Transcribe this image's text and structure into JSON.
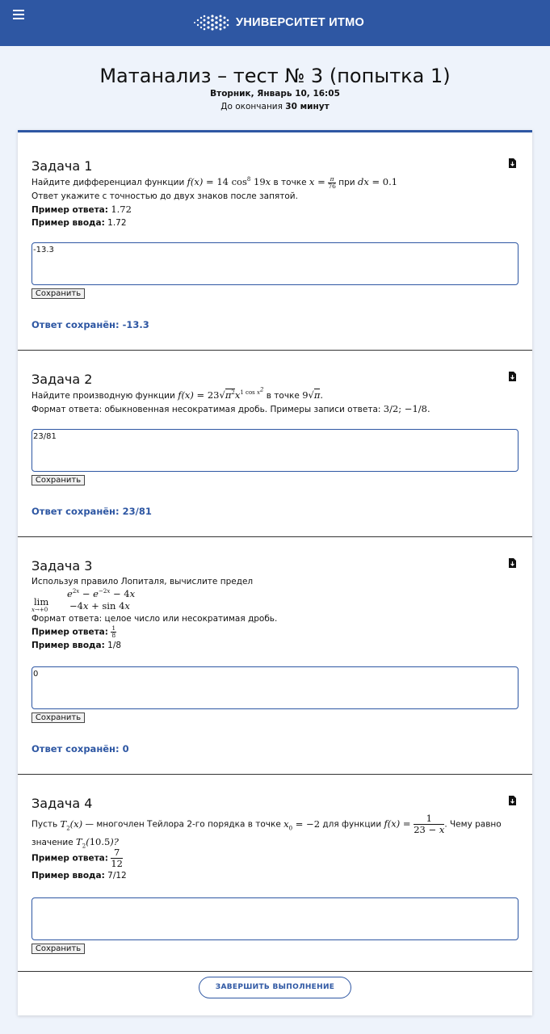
{
  "header": {
    "brand": "УНИВЕРСИТЕТ ИТМО",
    "menu_icon": "hamburger-menu-icon",
    "bg_color": "#2e57a3"
  },
  "page": {
    "title": "Матанализ – тест № 3 (попытка 1)",
    "date": "Вторник, Январь 10, 16:05",
    "time_left_prefix": "До окончания",
    "time_left_value": "30 минут"
  },
  "common": {
    "save_label": "Сохранить",
    "saved_prefix": "Ответ сохранён:",
    "example_answer_label": "Пример ответа:",
    "example_input_label": "Пример ввода:"
  },
  "tasks": [
    {
      "title": "Задача 1",
      "q_lead": "Найдите дифференциал функции",
      "q_at_point": "в точке",
      "q_with": "при",
      "q_precision": "Ответ укажите с точностью до двух знаков после запятой.",
      "example_answer": "1.72",
      "example_input": "1.72",
      "answer_value": "-13.3",
      "saved_value": "-13.3"
    },
    {
      "title": "Задача 2",
      "q_lead": "Найдите производную функции",
      "q_at_point": "в точке",
      "q_format": "Формат ответа: обыкновенная несократимая дробь. Примеры записи ответа:",
      "answer_value": "23/81",
      "saved_value": "23/81"
    },
    {
      "title": "Задача 3",
      "q_lead": "Используя правило Лопиталя, вычислите предел",
      "q_format": "Формат ответа: целое число или несократимая дробь.",
      "example_input": "1/8",
      "answer_value": "0",
      "saved_value": "0"
    },
    {
      "title": "Задача 4",
      "q_part1": "Пусть",
      "q_part2": "— многочлен Тейлора 2-го порядка в точке",
      "q_part3": "для функции",
      "q_part4": ". Чему равно",
      "q_part5": "значение",
      "example_input": "7/12",
      "answer_value": ""
    }
  ],
  "finish_label": "ЗАВЕРШИТЬ ВЫПОЛНЕНИЕ"
}
